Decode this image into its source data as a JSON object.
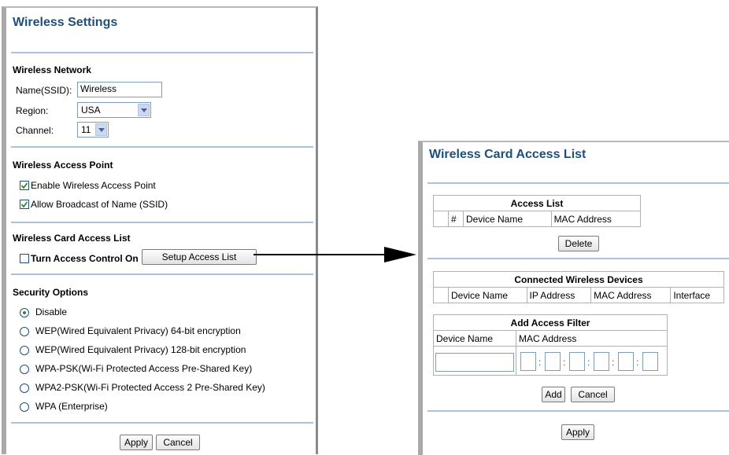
{
  "wireless_settings": {
    "title": "Wireless Settings",
    "network": {
      "heading": "Wireless Network",
      "name_label": "Name(SSID):",
      "name_value": "Wireless",
      "region_label": "Region:",
      "region_value": "USA",
      "channel_label": "Channel:",
      "channel_value": "11"
    },
    "access_point": {
      "heading": "Wireless Access Point",
      "enable_label": "Enable Wireless Access Point",
      "enable_checked": true,
      "broadcast_label": "Allow Broadcast of Name (SSID)",
      "broadcast_checked": true
    },
    "card_access": {
      "heading": "Wireless Card Access List",
      "toggle_label": "Turn Access Control On",
      "toggle_checked": false,
      "setup_button": "Setup Access List"
    },
    "security": {
      "heading": "Security Options",
      "options": [
        "Disable",
        "WEP(Wired Equivalent Privacy) 64-bit encryption",
        "WEP(Wired Equivalent Privacy) 128-bit encryption",
        "WPA-PSK(Wi-Fi Protected Access Pre-Shared Key)",
        "WPA2-PSK(Wi-Fi Protected Access 2 Pre-Shared Key)",
        "WPA (Enterprise)"
      ],
      "selected_index": 0
    },
    "apply_button": "Apply",
    "cancel_button": "Cancel"
  },
  "access_list_page": {
    "title": "Wireless Card Access List",
    "access_list": {
      "caption": "Access List",
      "columns": [
        "",
        "#",
        "Device Name",
        "MAC Address"
      ]
    },
    "delete_button": "Delete",
    "connected": {
      "caption": "Connected Wireless Devices",
      "columns": [
        "",
        "Device Name",
        "IP Address",
        "MAC Address",
        "Interface"
      ]
    },
    "add_filter": {
      "caption": "Add Access Filter",
      "device_name_label": "Device Name",
      "mac_label": "MAC Address"
    },
    "add_button": "Add",
    "cancel_button": "Cancel",
    "apply_button": "Apply"
  },
  "colors": {
    "title": "#1f4f7a",
    "divider": "#a8c4dc",
    "frame": "#a9a9a9"
  }
}
